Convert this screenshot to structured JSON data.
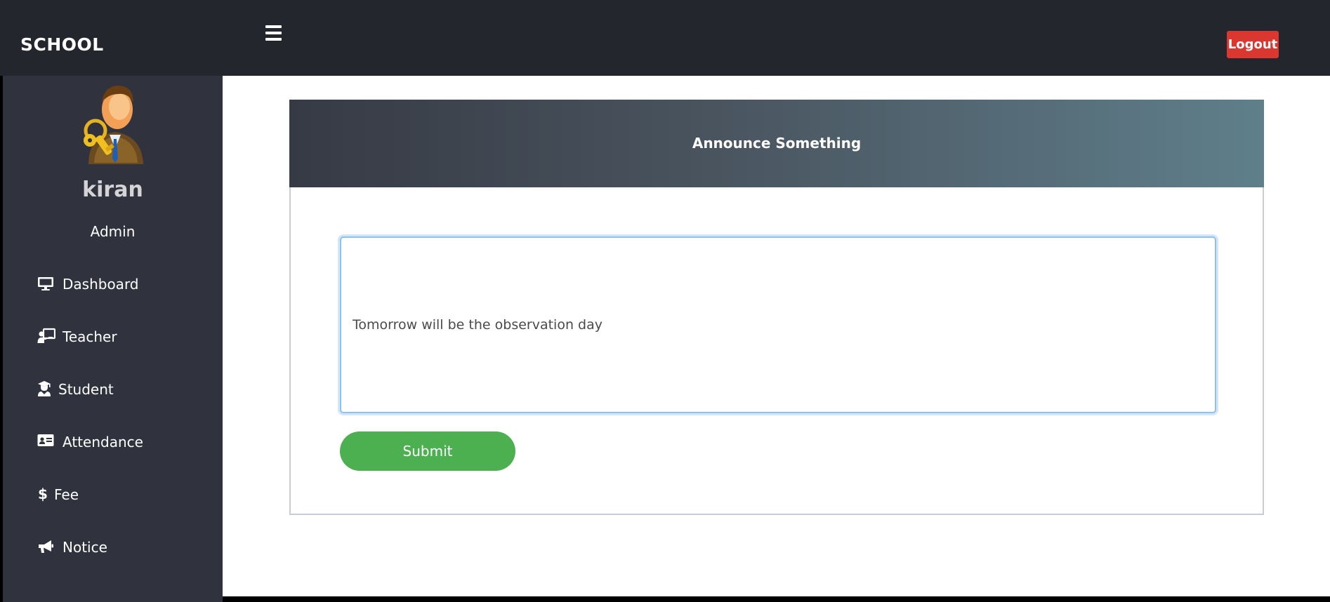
{
  "header": {
    "brand": "SCHOOL",
    "menu_icon": "hamburger-menu-icon",
    "logout_label": "Logout",
    "logout_color": "#d9372f"
  },
  "sidebar": {
    "avatar_icon": "admin-avatar-with-keys",
    "user_name": "kiran",
    "user_role": "Admin",
    "items": [
      {
        "label": "Dashboard",
        "icon": "desktop-monitor-icon"
      },
      {
        "label": "Teacher",
        "icon": "chalkboard-teacher-icon"
      },
      {
        "label": "Student",
        "icon": "user-graduate-icon"
      },
      {
        "label": "Attendance",
        "icon": "id-card-icon"
      },
      {
        "label": "Fee",
        "icon": "dollar-sign-icon"
      },
      {
        "label": "Notice",
        "icon": "bullhorn-icon"
      }
    ]
  },
  "main": {
    "card_title": "Announce Something",
    "announcement_value": "Tomorrow will be the observation day",
    "submit_label": "Submit",
    "submit_color": "#4caf50"
  }
}
